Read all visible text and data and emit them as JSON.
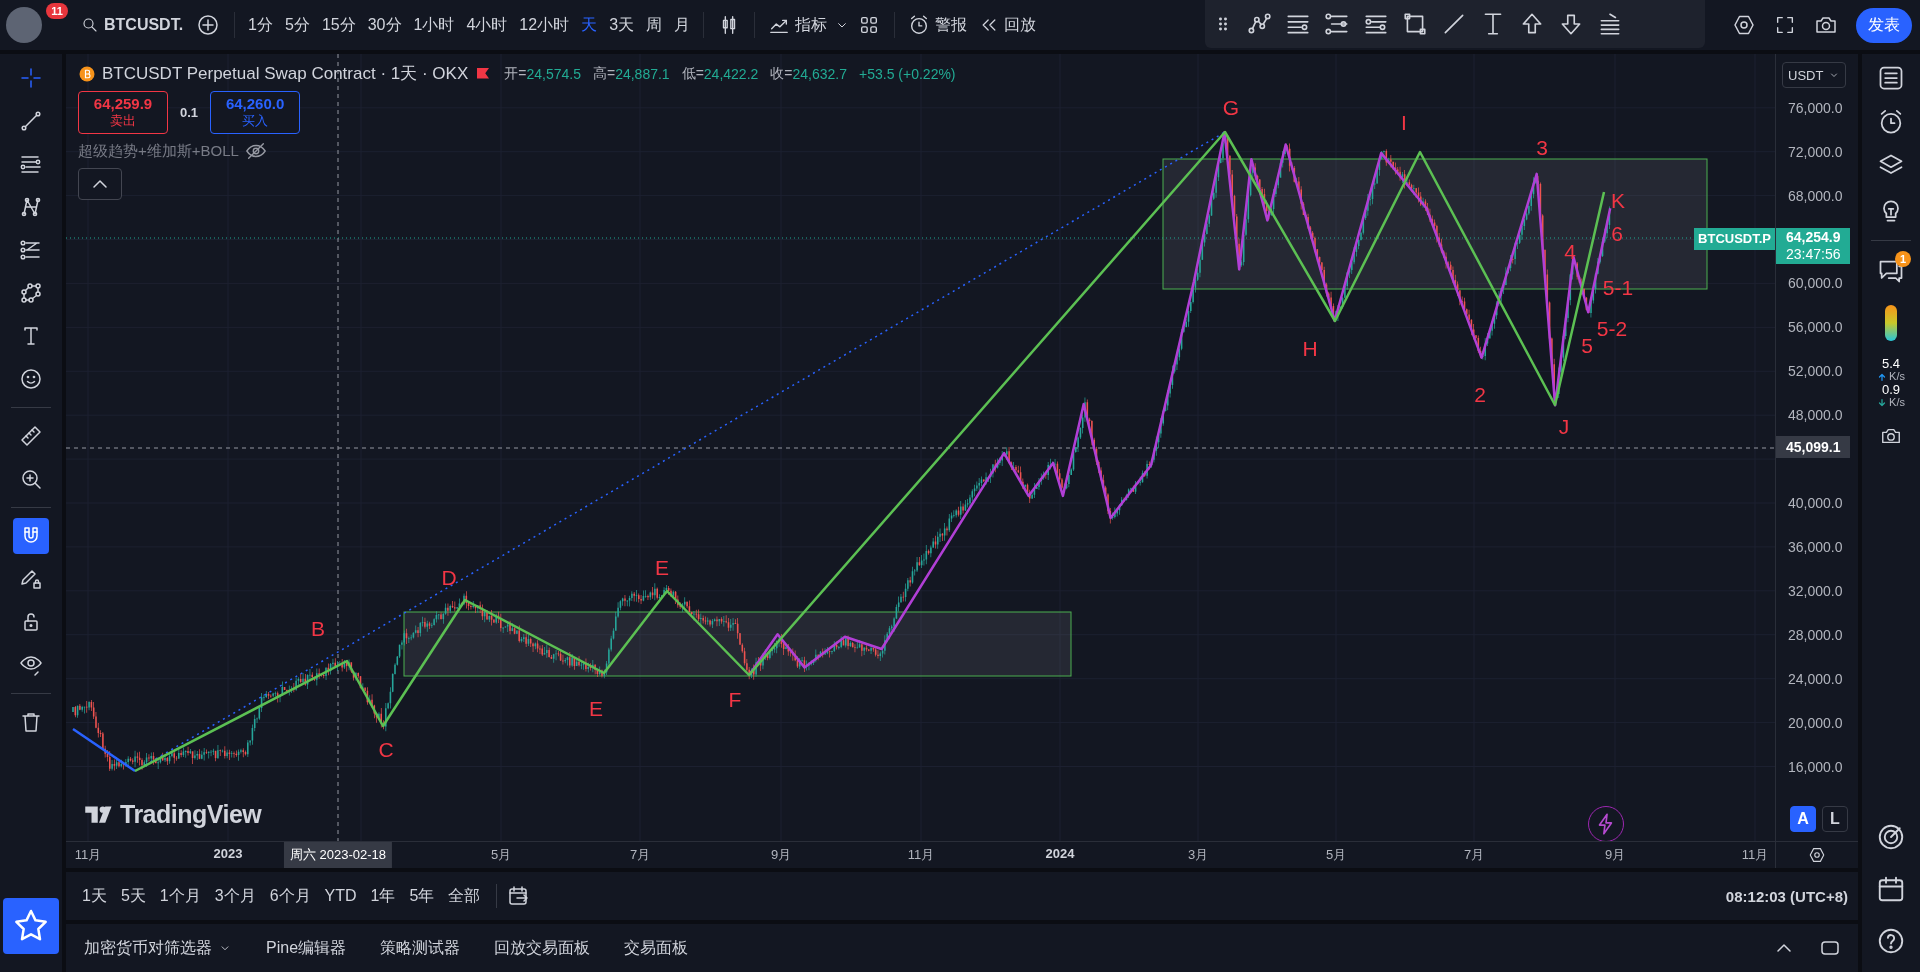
{
  "top_bar": {
    "avatar_badge": "11",
    "symbol": "BTCUSDT.",
    "intervals": [
      {
        "label": "1分",
        "selected": false
      },
      {
        "label": "5分",
        "selected": false
      },
      {
        "label": "15分",
        "selected": false
      },
      {
        "label": "30分",
        "selected": false
      },
      {
        "label": "1小时",
        "selected": false
      },
      {
        "label": "4小时",
        "selected": false
      },
      {
        "label": "12小时",
        "selected": false
      },
      {
        "label": "天",
        "selected": true
      },
      {
        "label": "3天",
        "selected": false
      },
      {
        "label": "周",
        "selected": false
      },
      {
        "label": "月",
        "selected": false
      }
    ],
    "indicators_label": "指标",
    "alerts_label": "警报",
    "replay_label": "回放",
    "publish_label": "发表"
  },
  "legend": {
    "title": "BTCUSDT Perpetual Swap Contract · 1天 · OKX",
    "ohlc": [
      {
        "label": "开=",
        "value": "24,574.5"
      },
      {
        "label": "高=",
        "value": "24,887.1"
      },
      {
        "label": "低=",
        "value": "24,422.2"
      },
      {
        "label": "收=",
        "value": "24,632.7"
      }
    ],
    "change": "+53.5 (+0.22%)",
    "sell": {
      "price": "64,259.9",
      "label": "卖出"
    },
    "spread": "0.1",
    "buy": {
      "price": "64,260.0",
      "label": "买入"
    },
    "indicator": "超级趋势+维加斯+BOLL"
  },
  "left_toolbar": [
    {
      "kind": "crosshair",
      "active": true
    },
    {
      "kind": "trend-line",
      "active": false
    },
    {
      "kind": "parallel",
      "active": false
    },
    {
      "kind": "pattern",
      "active": false
    },
    {
      "kind": "fib",
      "active": false
    },
    {
      "kind": "nodes",
      "active": false
    },
    {
      "kind": "text",
      "active": false
    },
    {
      "kind": "emoji",
      "active": false
    },
    {
      "kind": "ruler",
      "active": false
    },
    {
      "kind": "zoom",
      "active": false
    },
    {
      "kind": "magnet",
      "active": true
    },
    {
      "kind": "pencil-lock",
      "active": false
    },
    {
      "kind": "lock",
      "active": false
    },
    {
      "kind": "eye",
      "active": false
    },
    {
      "kind": "trash",
      "active": false
    }
  ],
  "chart": {
    "logo_text": "TradingView",
    "wave_labels": [
      "B",
      "C",
      "D",
      "E",
      "E",
      "F",
      "G",
      "H",
      "I",
      "J",
      "K",
      "3",
      "2",
      "4",
      "6",
      "5-1",
      "5-2",
      "5"
    ]
  },
  "price_axis": {
    "currency": "USDT",
    "ticks": [
      "76,000.0",
      "72,000.0",
      "68,000.0",
      "60,000.0",
      "56,000.0",
      "52,000.0",
      "48,000.0",
      "40,000.0",
      "36,000.0",
      "32,000.0",
      "28,000.0",
      "24,000.0",
      "20,000.0",
      "16,000.0"
    ],
    "symbol_tag": "BTCUSDT.P",
    "last_price": "64,254.9",
    "countdown": "23:47:56",
    "crosshair_price": "45,099.1",
    "scale_buttons": [
      {
        "label": "A",
        "selected": true
      },
      {
        "label": "L",
        "selected": false
      }
    ]
  },
  "time_axis": {
    "labels": [
      {
        "text": "11月",
        "kind": "month"
      },
      {
        "text": "2023",
        "kind": "year"
      },
      {
        "text": "周六 2023-02-18",
        "kind": "crosshair"
      },
      {
        "text": "5月",
        "kind": "month"
      },
      {
        "text": "7月",
        "kind": "month"
      },
      {
        "text": "9月",
        "kind": "month"
      },
      {
        "text": "11月",
        "kind": "month"
      },
      {
        "text": "2024",
        "kind": "year"
      },
      {
        "text": "3月",
        "kind": "month"
      },
      {
        "text": "5月",
        "kind": "month"
      },
      {
        "text": "7月",
        "kind": "month"
      },
      {
        "text": "9月",
        "kind": "month"
      },
      {
        "text": "11月",
        "kind": "month"
      }
    ]
  },
  "range_bar": {
    "ranges": [
      "1天",
      "5天",
      "1个月",
      "3个月",
      "6个月",
      "YTD",
      "1年",
      "5年",
      "全部"
    ],
    "clock": "08:12:03 (UTC+8)"
  },
  "bottom_panel": {
    "tabs": [
      {
        "label": "加密货币对筛选器",
        "dropdown": true
      },
      {
        "label": "Pine编辑器",
        "dropdown": false
      },
      {
        "label": "策略测试器",
        "dropdown": false
      },
      {
        "label": "回放交易面板",
        "dropdown": false
      },
      {
        "label": "交易面板",
        "dropdown": false
      }
    ]
  },
  "right_sidebar": {
    "chat_badge": "1",
    "upload_speed": "5.4",
    "upload_unit": "K/s",
    "download_speed": "0.9",
    "download_unit": "K/s"
  }
}
